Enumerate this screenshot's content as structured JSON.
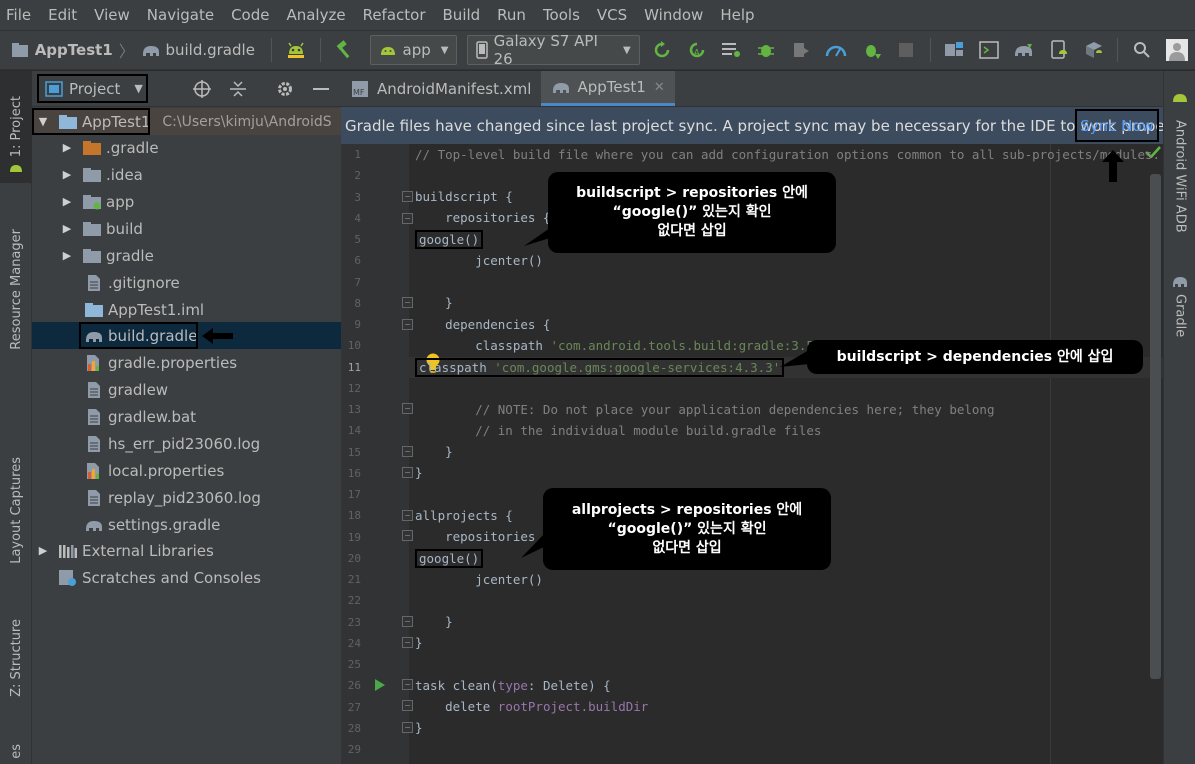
{
  "menu": [
    "File",
    "Edit",
    "View",
    "Navigate",
    "Code",
    "Analyze",
    "Refactor",
    "Build",
    "Run",
    "Tools",
    "VCS",
    "Window",
    "Help"
  ],
  "breadcrumb": {
    "project": "AppTest1",
    "file": "build.gradle"
  },
  "toolbar": {
    "run_config": "app",
    "device": "Galaxy S7 API 26"
  },
  "left_tabs": [
    "1: Project",
    "Resource Manager",
    "Layout Captures",
    "Z: Structure",
    "es"
  ],
  "right_tabs": [
    "Android WiFi ADB",
    "Gradle"
  ],
  "project_panel": {
    "view_selector": "Project",
    "root": {
      "name": "AppTest1",
      "path": "C:\\Users\\kimju\\AndroidS"
    },
    "items": [
      {
        "name": ".gradle"
      },
      {
        "name": ".idea"
      },
      {
        "name": "app"
      },
      {
        "name": "build"
      },
      {
        "name": "gradle"
      },
      {
        "name": ".gitignore"
      },
      {
        "name": "AppTest1.iml"
      },
      {
        "name": "build.gradle"
      },
      {
        "name": "gradle.properties"
      },
      {
        "name": "gradlew"
      },
      {
        "name": "gradlew.bat"
      },
      {
        "name": "hs_err_pid23060.log"
      },
      {
        "name": "local.properties"
      },
      {
        "name": "replay_pid23060.log"
      },
      {
        "name": "settings.gradle"
      },
      {
        "name": "External Libraries"
      },
      {
        "name": "Scratches and Consoles"
      }
    ]
  },
  "editor_tabs": [
    {
      "label": "AndroidManifest.xml"
    },
    {
      "label": "AppTest1"
    }
  ],
  "sync_bar": {
    "message": "Gradle files have changed since last project sync. A project sync may be necessary for the IDE to work properly.",
    "action": "Sync Now"
  },
  "code": {
    "line_numbers": [
      "1",
      "2",
      "3",
      "4",
      "5",
      "6",
      "7",
      "8",
      "9",
      "10",
      "11",
      "12",
      "13",
      "14",
      "15",
      "16",
      "17",
      "18",
      "19",
      "20",
      "21",
      "22",
      "23",
      "24",
      "25",
      "26",
      "27",
      "28",
      "29"
    ],
    "l1": "// Top-level build file where you can add configuration options common to all sub-projects/modules.",
    "l3": "buildscript {",
    "l4": "    repositories {",
    "l5": "google()",
    "l6": "        jcenter()",
    "l8": "    }",
    "l9": "    dependencies {",
    "l10_a": "        classpath ",
    "l10_b": "'com.android.tools.build:gradle:3.5.3'",
    "l11_a": "classpath ",
    "l11_b": "'com.google.gms:google-services:4.3.3'",
    "l13": "        // NOTE: Do not place your application dependencies here; they belong",
    "l14": "        // in the individual module build.gradle files",
    "l15": "    }",
    "l16": "}",
    "l18": "allprojects {",
    "l19": "    repositories {",
    "l20": "google()",
    "l21": "        jcenter()",
    "l23": "    }",
    "l24": "}",
    "l26_a": "task clean(",
    "l26_b": "type",
    "l26_c": ": Delete) {",
    "l27_a": "    delete ",
    "l27_b": "rootProject.buildDir",
    "l28": "}"
  },
  "callouts": {
    "c1": [
      "buildscript > repositories 안에",
      "“google()” 있는지 확인",
      "없다면 삽입"
    ],
    "c2": [
      "buildscript > dependencies 안에 삽입"
    ],
    "c3": [
      "allprojects > repositories 안에",
      "“google()” 있는지 확인",
      "없다면 삽입"
    ]
  },
  "colors": {
    "accent": "#4a88c7",
    "link": "#589df6",
    "android_green": "#a4c639"
  }
}
